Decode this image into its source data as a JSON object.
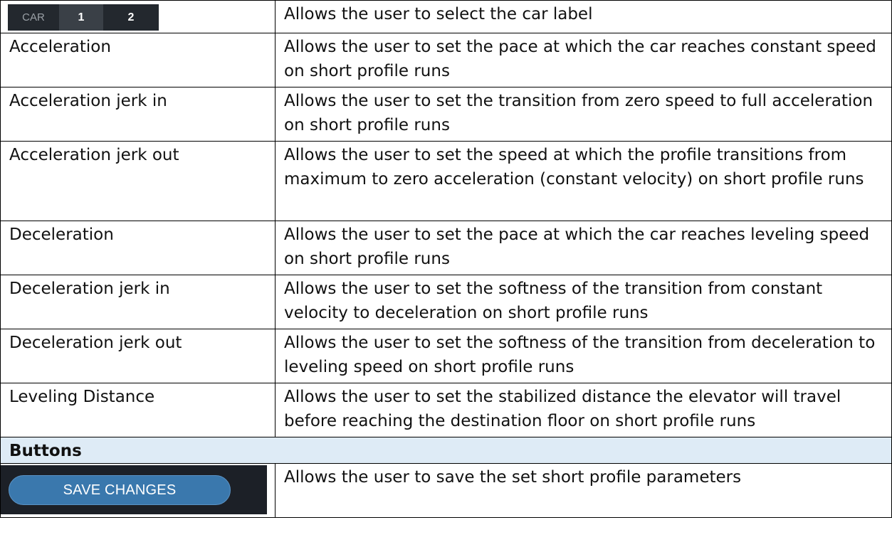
{
  "car_selector": {
    "label": "CAR",
    "options": [
      "1",
      "2"
    ],
    "description": "Allows the user to select the car label"
  },
  "rows": [
    {
      "name": "Acceleration",
      "description": "Allows the user to set the pace at which the car reaches constant speed on short profile runs"
    },
    {
      "name": "Acceleration jerk in",
      "description": "Allows the user to set the transition from zero speed to full acceleration on short profile runs"
    },
    {
      "name": "Acceleration jerk out",
      "description": "Allows the user to set the speed at which the profile transitions from maximum to zero acceleration (constant velocity) on short profile runs"
    },
    {
      "name": "Deceleration",
      "description": "Allows the user to set the pace at which the car reaches leveling speed on short profile runs"
    },
    {
      "name": "Deceleration jerk in",
      "description": "Allows the user to set the softness of the transition from constant velocity to deceleration on short profile runs"
    },
    {
      "name": "Deceleration jerk out",
      "description": "Allows the user to set the softness of the transition from deceleration to leveling speed on short profile runs"
    },
    {
      "name": "Leveling Distance",
      "description": "Allows the user to set the stabilized distance the elevator will travel before reaching the destination floor on short profile runs"
    }
  ],
  "buttons_section": {
    "heading": "Buttons",
    "save_button_label": "SAVE CHANGES",
    "save_description": "Allows the user to save the set short profile parameters"
  },
  "colors": {
    "section_header_bg": "#deebf6",
    "widget_bg": "#23282e",
    "save_button_bg": "#3a78ad"
  }
}
